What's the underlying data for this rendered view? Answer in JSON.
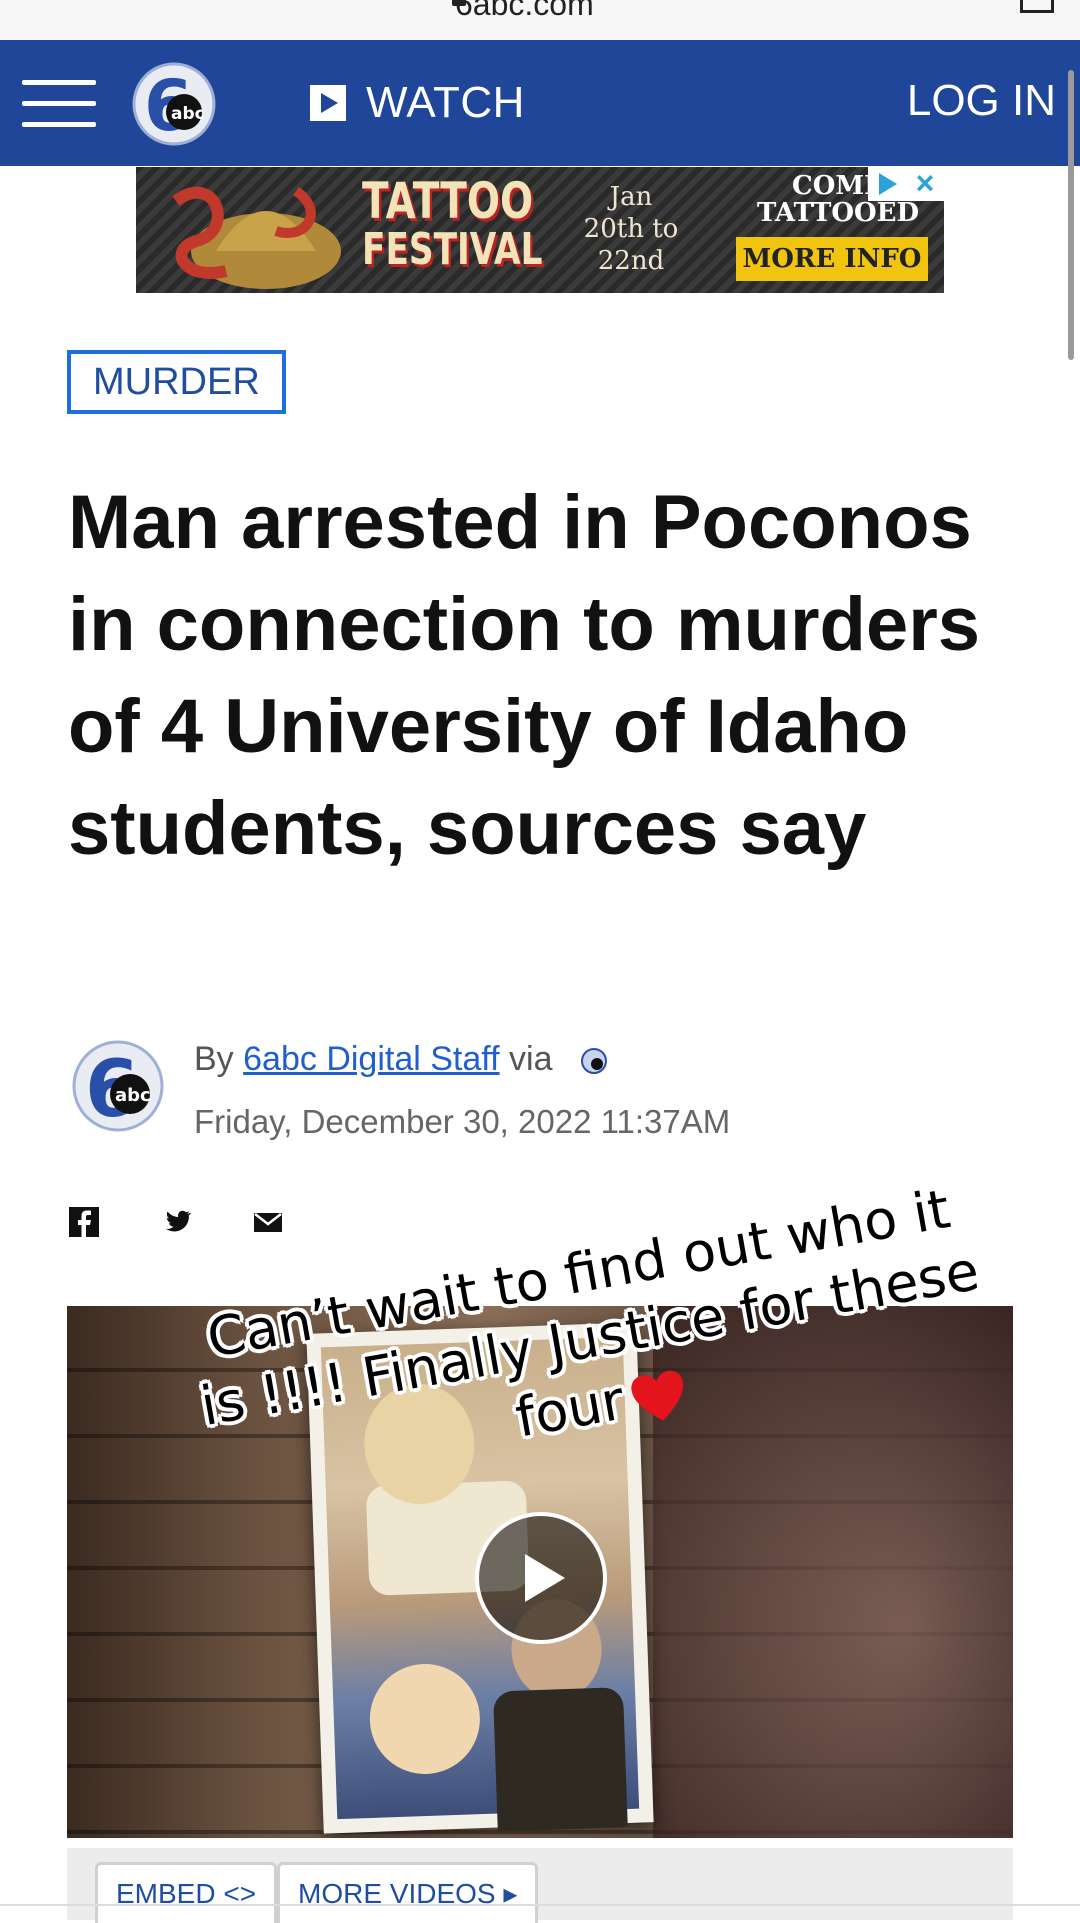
{
  "browser": {
    "url": "6abc.com"
  },
  "header": {
    "logo": "6abc-logo",
    "watch_label": "WATCH",
    "login_label": "LOG IN"
  },
  "ad": {
    "title_line1": "TATTOO",
    "title_line2": "FESTIVAL",
    "dates_line1": "Jan",
    "dates_line2": "20th to",
    "dates_line3": "22nd",
    "come_line1": "COME",
    "come_line2": "TATTOOED",
    "more_info": "MORE INFO"
  },
  "article": {
    "category": "MURDER",
    "headline": "Man arrested in Poconos in connection to murders of 4 University of Idaho students, sources say",
    "byline_prefix": "By",
    "author": "6abc Digital Staff",
    "via": "via",
    "date": "Friday, December 30, 2022 11:37AM"
  },
  "video": {
    "caption": "Can’t wait to find out who it is !!!! Finally Justice for these four",
    "embed_label": "EMBED <>",
    "more_videos_label": "MORE VIDEOS ▸"
  },
  "colors": {
    "header_bg": "#1f4699",
    "tag_border": "#1f6fe0",
    "link": "#1f5fd0",
    "ad_button": "#f1c40f"
  }
}
